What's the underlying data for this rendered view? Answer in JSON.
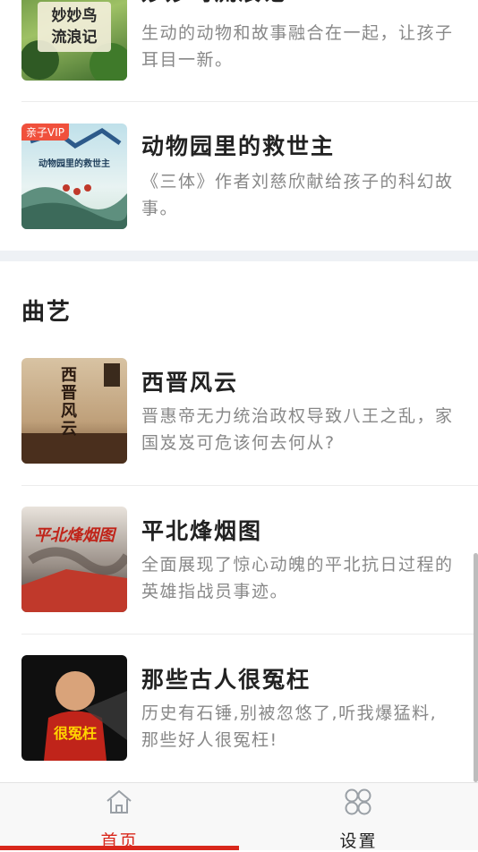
{
  "sections": {
    "kids": {
      "items": [
        {
          "title": "妙妙鸟流浪记",
          "description": "生动的动物和故事融合在一起，让孩子耳目一新。",
          "cover_text": "妙妙鸟\n流浪记"
        },
        {
          "title": "动物园里的救世主",
          "description": "《三体》作者刘慈欣献给孩子的科幻故事。",
          "badge": "亲子VIP",
          "cover_text": "动物园里的救世主"
        }
      ]
    },
    "quyi": {
      "title": "曲艺",
      "items": [
        {
          "title": "西晋风云",
          "description": "晋惠帝无力统治政权导致八王之乱，家国岌岌可危该何去何从?",
          "cover_text": "西晋风云"
        },
        {
          "title": "平北烽烟图",
          "description": "全面展现了惊心动魄的平北抗日过程的英雄指战员事迹。",
          "cover_text": "平北烽烟图"
        },
        {
          "title": "那些古人很冤枉",
          "description": "历史有石锤,别被忽悠了,听我爆猛料,那些好人很冤枉!",
          "cover_text": "很冤枉"
        }
      ]
    }
  },
  "tabbar": {
    "home_label": "首页",
    "settings_label": "设置",
    "active_color": "#d9281c"
  }
}
